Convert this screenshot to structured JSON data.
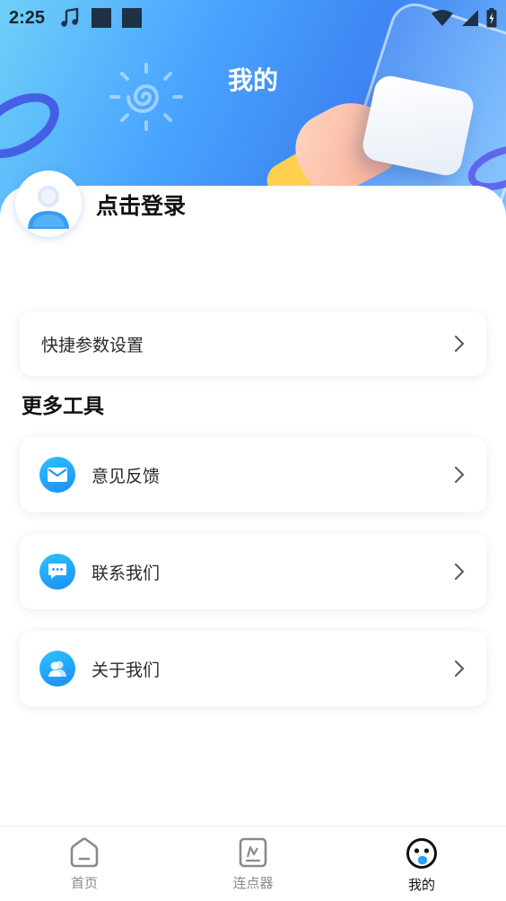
{
  "status_bar": {
    "time": "2:25"
  },
  "header": {
    "title": "我的"
  },
  "profile": {
    "login_label": "点击登录"
  },
  "quick_settings": {
    "label": "快捷参数设置"
  },
  "more_tools": {
    "title": "更多工具",
    "items": [
      {
        "label": "意见反馈",
        "icon": "mail-icon"
      },
      {
        "label": "联系我们",
        "icon": "chat-icon"
      },
      {
        "label": "关于我们",
        "icon": "people-icon"
      }
    ]
  },
  "tabbar": {
    "tabs": [
      {
        "label": "首页",
        "icon": "home-icon",
        "active": false
      },
      {
        "label": "连点器",
        "icon": "clicker-icon",
        "active": false
      },
      {
        "label": "我的",
        "icon": "profile-face-icon",
        "active": true
      }
    ]
  },
  "colors": {
    "accent": "#1a8ef5",
    "header_start": "#6fd0f8",
    "header_end": "#3d86f3"
  }
}
